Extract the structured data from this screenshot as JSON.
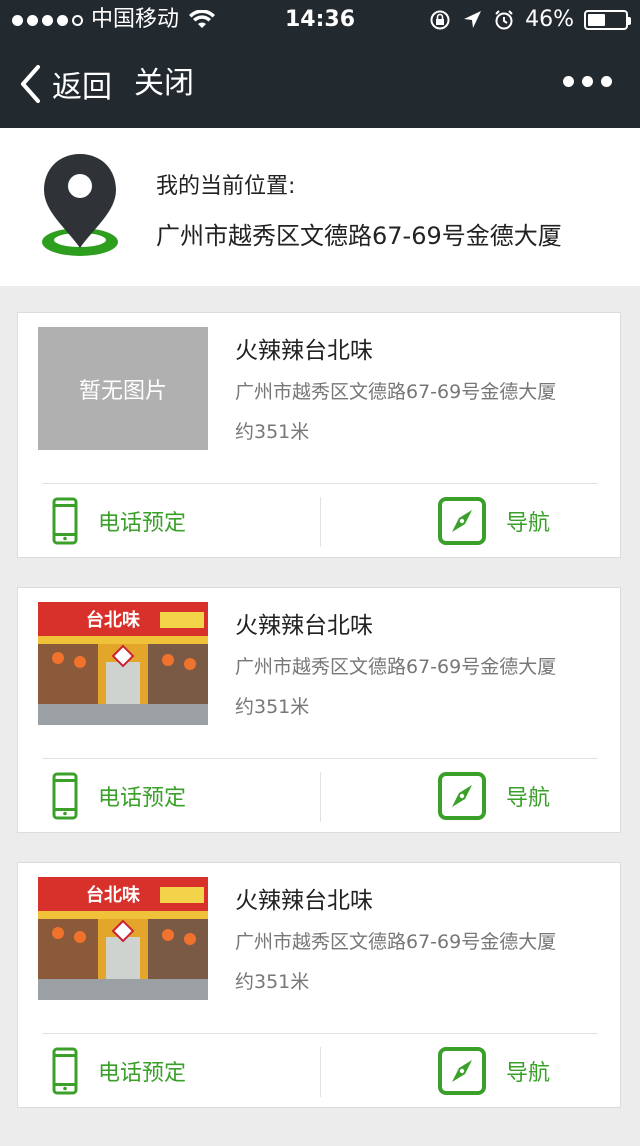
{
  "status_bar": {
    "carrier": "中国移动",
    "time": "14:36",
    "battery": "46%",
    "battery_level": 0.46
  },
  "nav": {
    "back_label": "返回",
    "close_label": "关闭"
  },
  "location": {
    "label": "我的当前位置:",
    "address": "广州市越秀区文德路67-69号金德大厦"
  },
  "restaurants": [
    {
      "name": "火辣辣台北味",
      "address": "广州市越秀区文德路67-69号金德大厦",
      "distance": "约351米",
      "image_placeholder": "暂无图片",
      "phone_label": "电话预定",
      "navigate_label": "导航"
    },
    {
      "name": "火辣辣台北味",
      "address": "广州市越秀区文德路67-69号金德大厦",
      "distance": "约351米",
      "sign_text": "台北味",
      "phone_label": "电话预定",
      "navigate_label": "导航"
    },
    {
      "name": "火辣辣台北味",
      "address": "广州市越秀区文德路67-69号金德大厦",
      "distance": "约351米",
      "sign_text": "台北味",
      "phone_label": "电话预定",
      "navigate_label": "导航"
    }
  ],
  "colors": {
    "top_bar": "#232a2f",
    "accent_green": "#3aa02a",
    "page_bg": "#ececec"
  }
}
